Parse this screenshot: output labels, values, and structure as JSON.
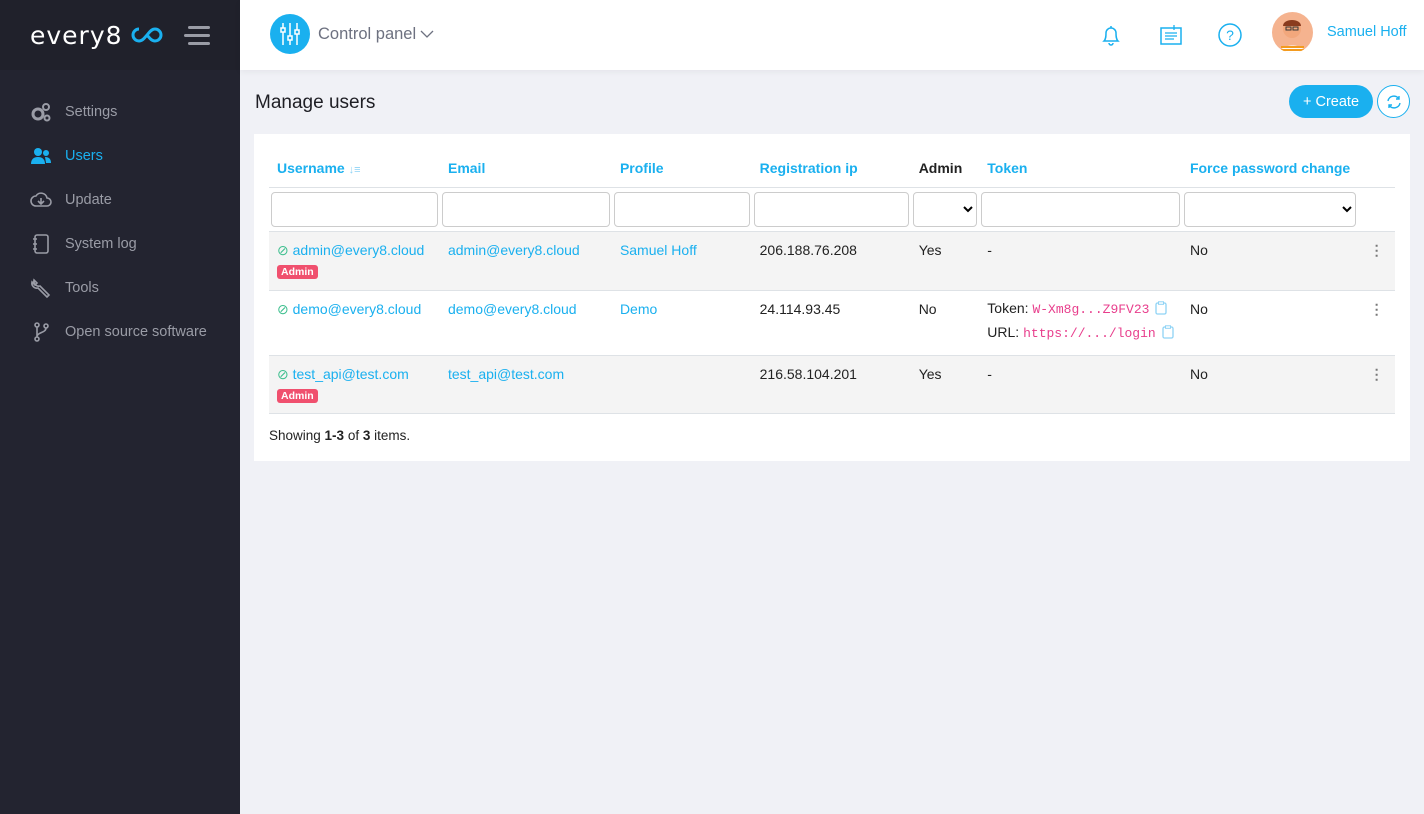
{
  "brand": {
    "name": "every8",
    "accent": "#1ab0ef"
  },
  "sidebar": {
    "items": [
      {
        "label": "Settings",
        "icon": "gears-icon",
        "active": false
      },
      {
        "label": "Users",
        "icon": "users-icon",
        "active": true
      },
      {
        "label": "Update",
        "icon": "cloud-download-icon",
        "active": false
      },
      {
        "label": "System log",
        "icon": "notebook-icon",
        "active": false
      },
      {
        "label": "Tools",
        "icon": "wrench-icon",
        "active": false
      },
      {
        "label": "Open source software",
        "icon": "git-branch-icon",
        "active": false
      }
    ]
  },
  "header": {
    "app_menu": "Control panel",
    "user_name": "Samuel Hoff"
  },
  "page": {
    "title": "Manage users",
    "create_label": "+ Create"
  },
  "table": {
    "columns": [
      "Username",
      "Email",
      "Profile",
      "Registration ip",
      "Admin",
      "Token",
      "Force password change"
    ],
    "rows": [
      {
        "username": "admin@every8.cloud",
        "badge": "Admin",
        "email": "admin@every8.cloud",
        "profile": "Samuel Hoff",
        "ip": "206.188.76.208",
        "admin": "Yes",
        "token": "-",
        "force": "No"
      },
      {
        "username": "demo@every8.cloud",
        "badge": "",
        "email": "demo@every8.cloud",
        "profile": "Demo",
        "ip": "24.114.93.45",
        "admin": "No",
        "token_label": "Token:",
        "token_value": "W-Xm8g...Z9FV23",
        "url_label": "URL:",
        "url_value": "https://.../login",
        "force": "No"
      },
      {
        "username": "test_api@test.com",
        "badge": "Admin",
        "email": "test_api@test.com",
        "profile": "",
        "ip": "216.58.104.201",
        "admin": "Yes",
        "token": "-",
        "force": "No"
      }
    ]
  },
  "footer": {
    "prefix": "Showing ",
    "range": "1-3",
    "mid": " of ",
    "total": "3",
    "suffix": " items."
  }
}
